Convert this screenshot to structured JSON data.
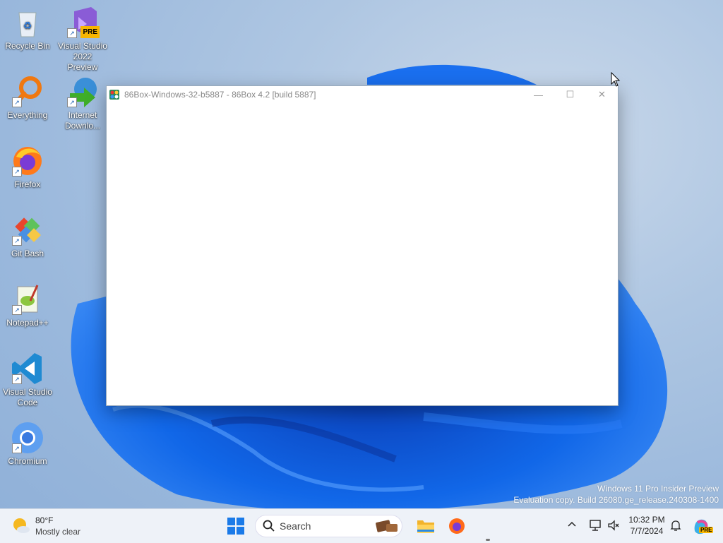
{
  "desktop": {
    "icons": [
      {
        "label": "Recycle Bin"
      },
      {
        "label": "Visual Studio 2022 Preview",
        "badge": "PRE"
      },
      {
        "label": "Everything"
      },
      {
        "label": "Internet Downlo..."
      },
      {
        "label": "Firefox"
      },
      {
        "label": "Git Bash"
      },
      {
        "label": "Notepad++"
      },
      {
        "label": "Visual Studio Code"
      },
      {
        "label": "Chromium"
      }
    ]
  },
  "window": {
    "title": "86Box-Windows-32-b5887 - 86Box 4.2 [build 5887]",
    "controls": {
      "minimize": "—",
      "maximize": "☐",
      "close": "✕"
    }
  },
  "watermark": {
    "line1": "Windows 11 Pro Insider Preview",
    "line2": "Evaluation copy. Build 26080.ge_release.240308-1400"
  },
  "taskbar": {
    "weather": {
      "temp": "80°F",
      "condition": "Mostly clear"
    },
    "search": {
      "placeholder": "Search"
    },
    "clock": {
      "time": "10:32 PM",
      "date": "7/7/2024"
    },
    "copilot_badge": "PRE"
  },
  "colors": {
    "accent": "#0a5fd1",
    "taskbar_bg": "#eef2f8"
  }
}
